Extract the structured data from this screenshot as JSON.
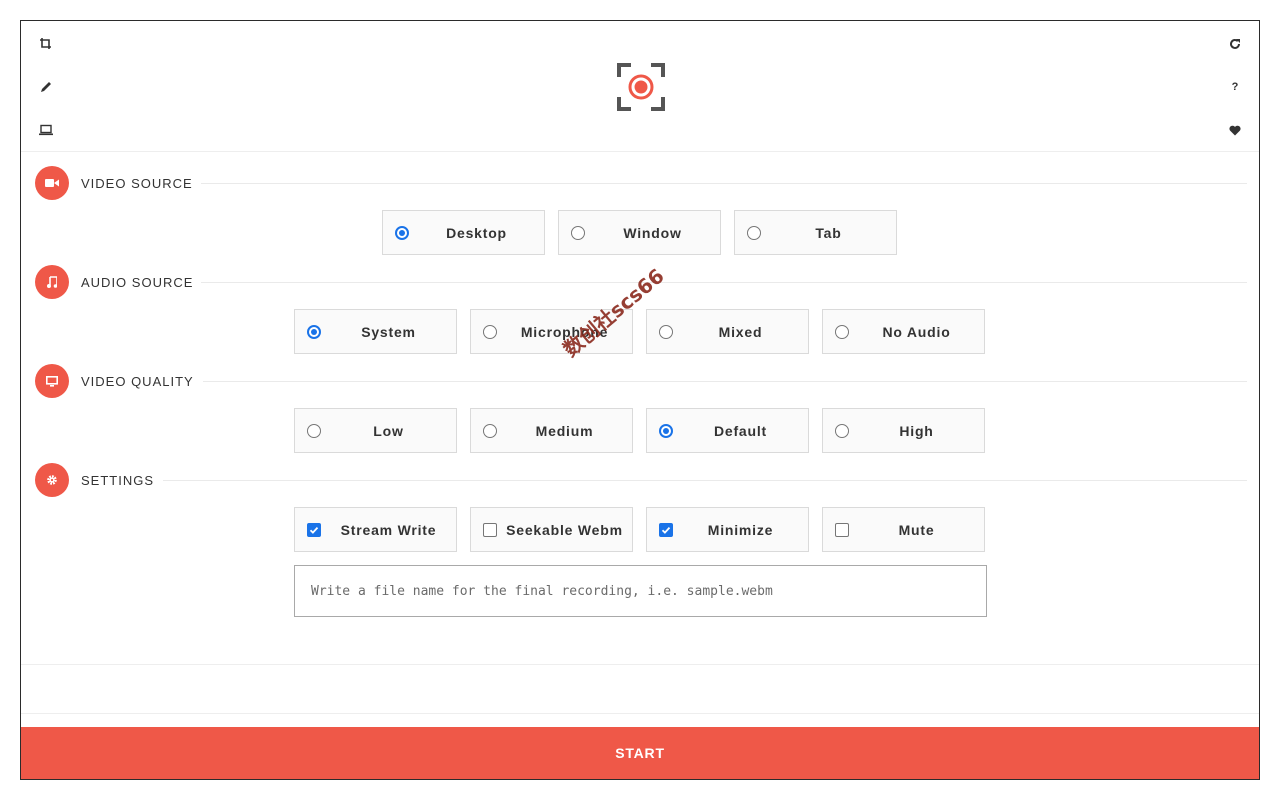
{
  "left_toolbar": {
    "icons": [
      "crop-icon",
      "pencil-icon",
      "laptop-icon"
    ]
  },
  "right_toolbar": {
    "icons": [
      "reload-icon",
      "help-icon",
      "heart-icon"
    ],
    "help_glyph": "?"
  },
  "logo": {
    "icon": "record-target-icon",
    "accent": "#ef5848"
  },
  "sections": {
    "video_source": {
      "title": "VIDEO SOURCE",
      "icon": "video-camera-icon",
      "options": [
        {
          "label": "Desktop",
          "checked": true
        },
        {
          "label": "Window",
          "checked": false
        },
        {
          "label": "Tab",
          "checked": false
        }
      ]
    },
    "audio_source": {
      "title": "AUDIO SOURCE",
      "icon": "music-note-icon",
      "options": [
        {
          "label": "System",
          "checked": true
        },
        {
          "label": "Microphone",
          "checked": false
        },
        {
          "label": "Mixed",
          "checked": false
        },
        {
          "label": "No Audio",
          "checked": false
        }
      ]
    },
    "video_quality": {
      "title": "VIDEO QUALITY",
      "icon": "monitor-icon",
      "options": [
        {
          "label": "Low",
          "checked": false
        },
        {
          "label": "Medium",
          "checked": false
        },
        {
          "label": "Default",
          "checked": true
        },
        {
          "label": "High",
          "checked": false
        }
      ]
    },
    "settings": {
      "title": "SETTINGS",
      "icon": "gear-icon",
      "options": [
        {
          "label": "Stream Write",
          "checked": true
        },
        {
          "label": "Seekable Webm",
          "checked": false
        },
        {
          "label": "Minimize",
          "checked": true
        },
        {
          "label": "Mute",
          "checked": false
        }
      ]
    }
  },
  "filename": {
    "placeholder": "Write a file name for the final recording, i.e. sample.webm",
    "value": ""
  },
  "start_button": {
    "label": "START"
  },
  "watermark": {
    "text": "数创社scs66"
  },
  "colors": {
    "accent": "#ef5848",
    "control_blue": "#1a73e8"
  }
}
